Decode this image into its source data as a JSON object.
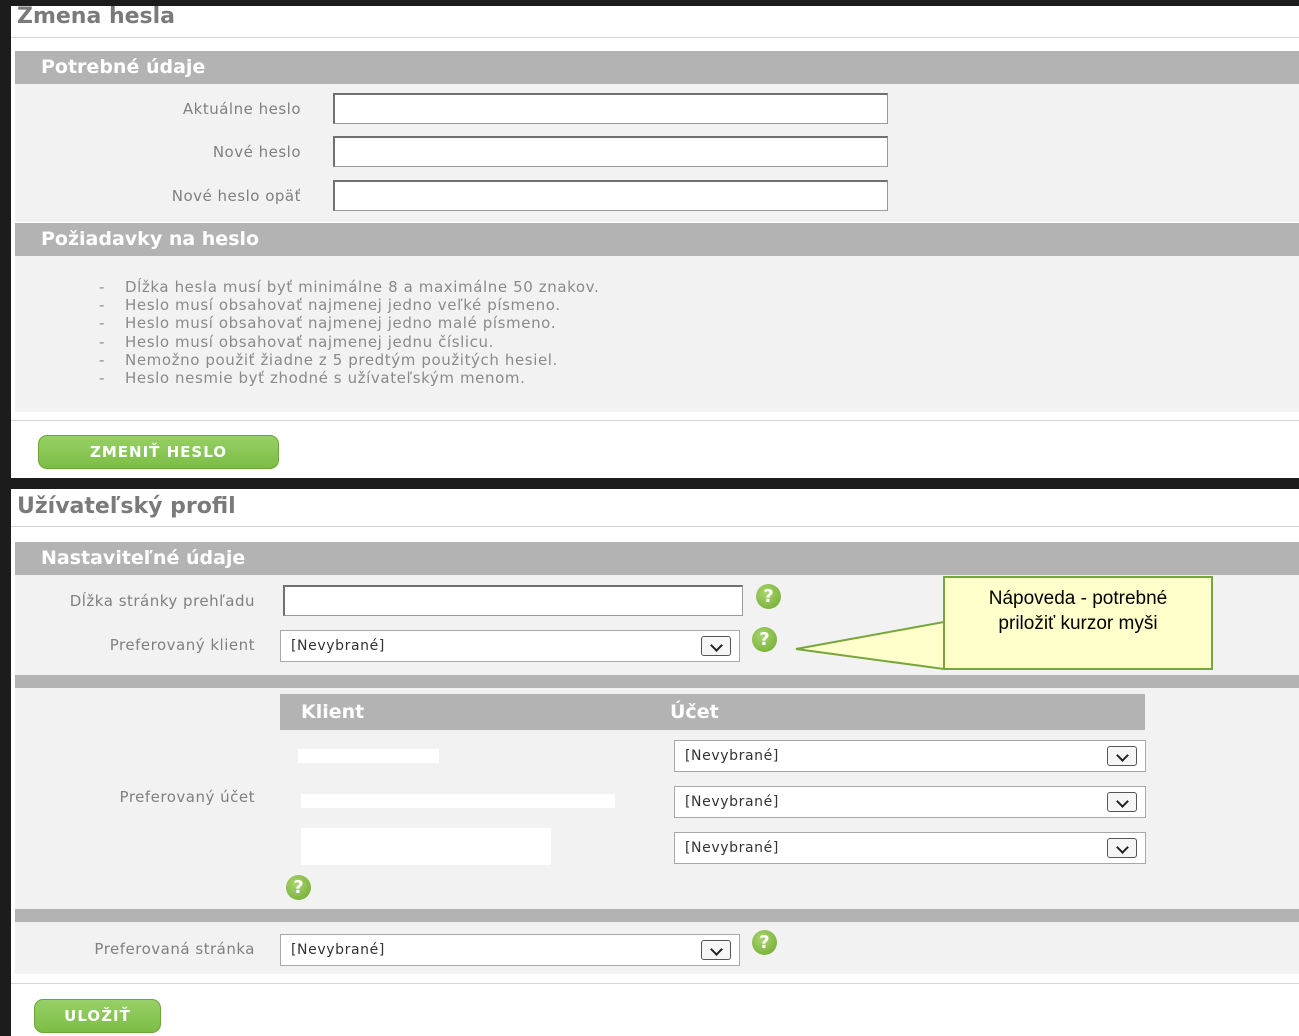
{
  "password_change": {
    "title": "Zmena hesla",
    "section_required": "Potrebné údaje",
    "fields": [
      {
        "label": "Aktuálne heslo",
        "value": ""
      },
      {
        "label": "Nové heslo",
        "value": ""
      },
      {
        "label": "Nové heslo opäť",
        "value": ""
      }
    ],
    "section_requirements": "Požiadavky na heslo",
    "requirements": [
      "Dĺžka hesla musí byť minimálne 8 a maximálne 50 znakov.",
      "Heslo musí obsahovať najmenej jedno veľké písmeno.",
      "Heslo musí obsahovať najmenej jedno malé písmeno.",
      "Heslo musí obsahovať najmenej jednu číslicu.",
      "Nemožno použiť žiadne z 5 predtým použitých hesiel.",
      "Heslo nesmie byť zhodné s užívateľským menom."
    ],
    "submit_label": "ZMENIŤ HESLO"
  },
  "user_profile": {
    "title": "Užívateľský profil",
    "section_settings": "Nastaviteľné údaje",
    "page_length_label": "Dĺžka stránky prehľadu",
    "page_length_value": "",
    "preferred_client_label": "Preferovaný klient",
    "preferred_client_value": "[Nevybrané]",
    "preferred_account_label": "Preferovaný účet",
    "table_headers": {
      "client": "Klient",
      "account": "Účet"
    },
    "account_selects": [
      "[Nevybrané]",
      "[Nevybrané]",
      "[Nevybrané]"
    ],
    "preferred_page_label": "Preferovaná stránka",
    "preferred_page_value": "[Nevybrané]",
    "save_label": "ULOŽIŤ",
    "help_glyph": "?",
    "callout_line1": "Nápoveda - potrebné",
    "callout_line2": "priložiť kurzor myši"
  },
  "icons": {
    "help": "question-circle-icon",
    "dropdown": "chevron-down-icon"
  },
  "colors": {
    "accent_green": "#7cbd45",
    "section_gray": "#b3b3b3",
    "callout_bg": "#ffffcc"
  }
}
